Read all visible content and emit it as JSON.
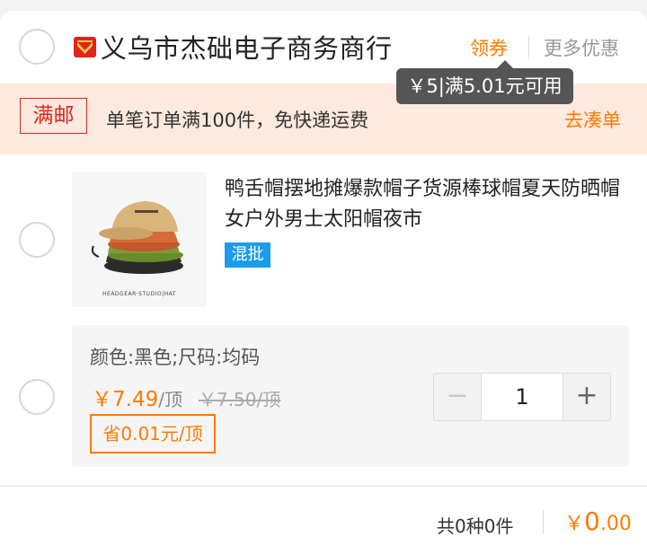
{
  "shop": {
    "name": "义乌市杰础电子商务商行",
    "coupon_label": "领券",
    "more_label": "更多优惠",
    "coupon_tip": "￥5|满5.01元可用"
  },
  "shipping": {
    "badge": "满邮",
    "text": "单笔订单满100件，免快递运费",
    "action": "去凑单"
  },
  "product": {
    "title": "鸭舌帽摆地摊爆款帽子货源棒球帽夏天防晒帽女户外男士太阳帽夜市",
    "tag": "混批",
    "image_caption": "HEADGEAR·STUDIO|HAT",
    "sku": {
      "spec": "颜色:黑色;尺码:均码",
      "price_now": "￥7.49",
      "price_unit": "/顶",
      "price_old": "￥7.50/顶",
      "saving": "省0.01元/顶",
      "quantity": "1",
      "minus_symbol": "−",
      "plus_symbol": "+"
    }
  },
  "summary": {
    "count_text": "共0种0件",
    "total_symbol": "￥",
    "total_int": "0",
    "total_dec": ".00"
  },
  "colors": {
    "accent": "#ff7a00",
    "brand_red": "#e2231a",
    "tag_blue": "#1c9bea",
    "tooltip_bg": "#555555",
    "shipping_bg": "#fde9de"
  },
  "icons": {
    "shop_logo": "shop-logo-icon",
    "select": "radio-circle-icon"
  }
}
